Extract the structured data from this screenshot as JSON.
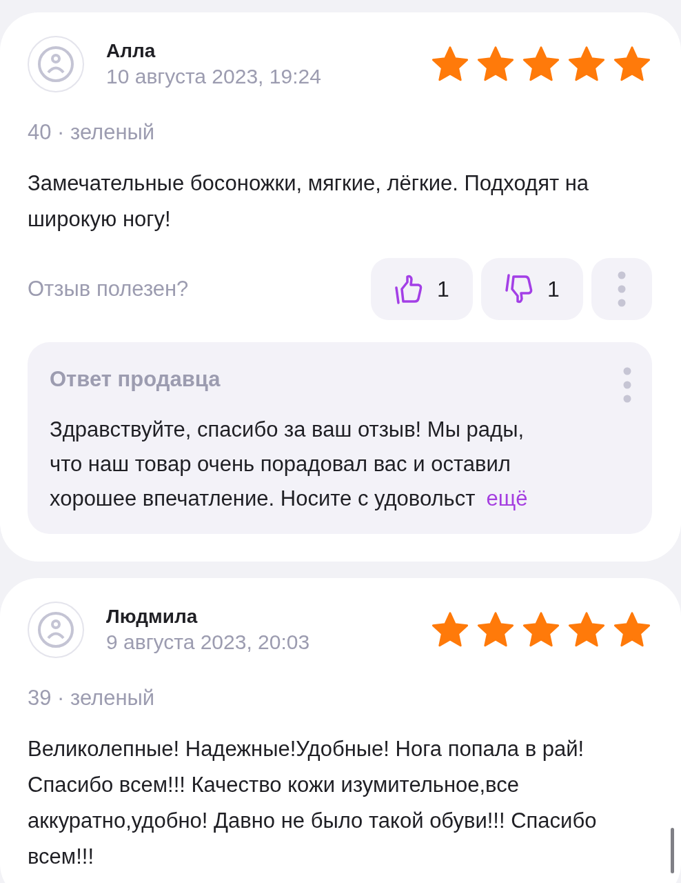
{
  "reviews": [
    {
      "author": "Алла",
      "date": "10 августа 2023, 19:24",
      "stars": 5,
      "variant": "40 · зеленый",
      "text": "Замечательные босоножки, мягкие, лёгкие. Подходят на широкую ногу!",
      "helpful": {
        "question": "Отзыв полезен?",
        "likes": "1",
        "dislikes": "1"
      },
      "seller_reply": {
        "title": "Ответ продавца",
        "lines": [
          "Здравствуйте, спасибо за ваш отзыв! Мы рады,",
          "что наш товар очень порадовал вас и оставил",
          "хорошее впечатление. Носите с удовольст"
        ],
        "more": "ещё"
      }
    },
    {
      "author": "Людмила",
      "date": "9 августа 2023, 20:03",
      "stars": 5,
      "variant": "39 · зеленый",
      "text": "Великолепные! Надежные!Удобные! Нога попала в рай! Спасибо всем!!! Качество кожи изумительное,все аккуратно,удобно! Давно не было такой обуви!!! Спасибо всем!!!"
    }
  ]
}
